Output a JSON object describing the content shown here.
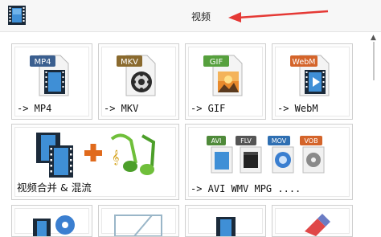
{
  "window": {
    "title": "视频"
  },
  "colors": {
    "accent_arrow": "#e53935",
    "mp4": "#3b5f8f",
    "mkv": "#8a6a2e",
    "gif": "#56a03d",
    "webm": "#d4642a"
  },
  "tiles": [
    {
      "label": "-> MP4",
      "badge": "MP4"
    },
    {
      "label": "-> MKV",
      "badge": "MKV"
    },
    {
      "label": "-> GIF",
      "badge": "GIF"
    },
    {
      "label": "-> WebM",
      "badge": "WebM"
    },
    {
      "label": "视频合并 & 混流"
    },
    {
      "label": "-> AVI WMV MPG ....",
      "badges": [
        "AVI",
        "FLV",
        "MOV",
        "VOB"
      ]
    }
  ],
  "icons": {
    "title": "film-strip-icon",
    "arrow": "red-arrow-annotation",
    "mp4": "mp4-file-icon",
    "mkv": "mkv-file-icon",
    "gif": "gif-file-icon",
    "webm": "webm-file-icon",
    "merge": "merge-mux-icon",
    "formats": "multi-format-icon"
  }
}
